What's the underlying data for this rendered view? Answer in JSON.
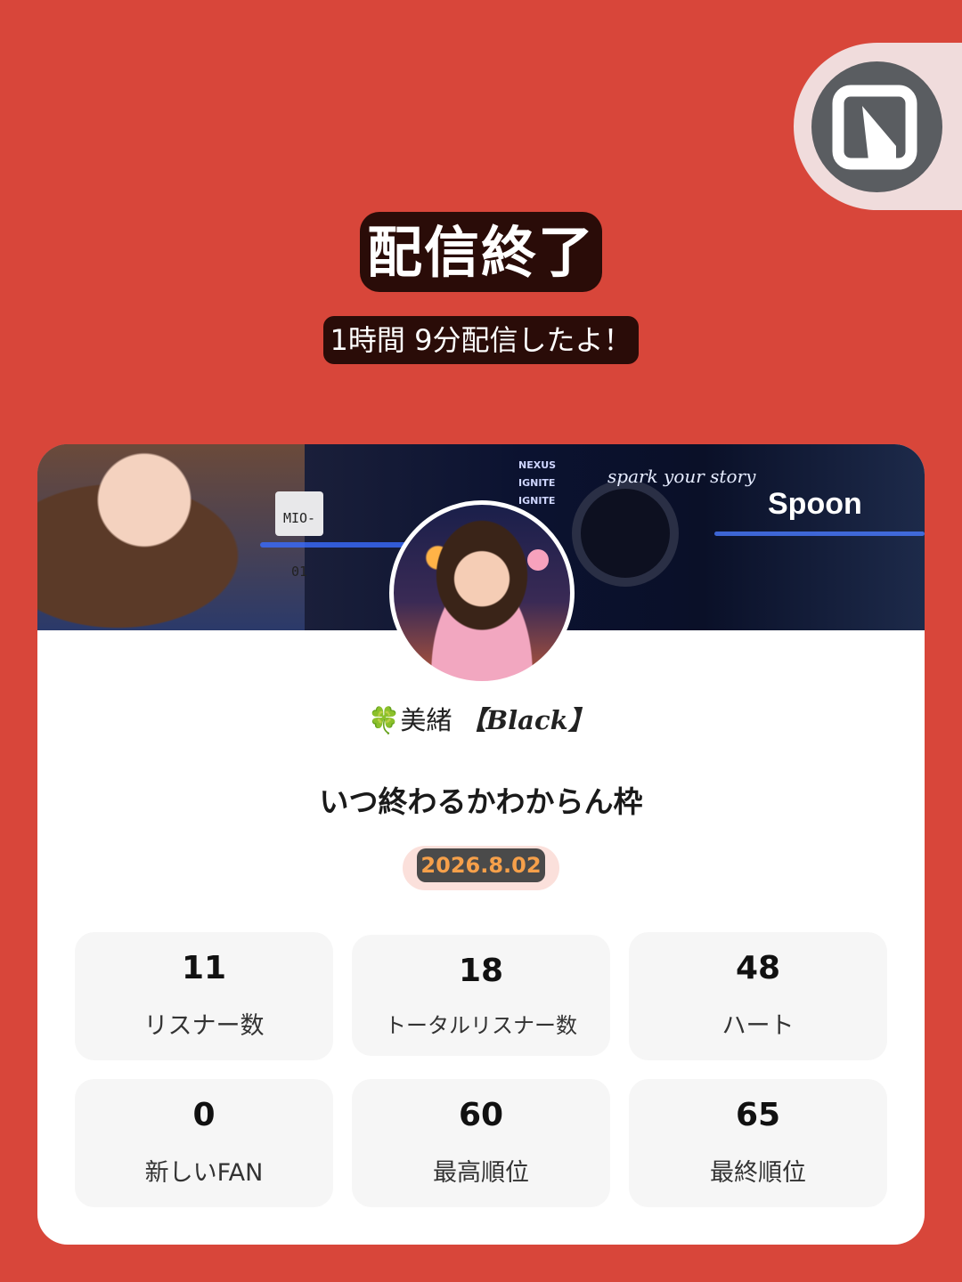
{
  "header": {
    "title": "配信終了",
    "subtitle": "1時間 9分配信したよ！"
  },
  "card": {
    "banner": {
      "plate": "MIO-01",
      "tag_lines": [
        "NEXUS",
        "IGNITE",
        "IGNITE"
      ],
      "tagline": "spark your story",
      "brand": "Spoon"
    },
    "user": {
      "clover": "🍀",
      "name": "美緒",
      "suffix": "【Black】"
    },
    "live_title": "いつ終わるかわからん枠",
    "date": "2026.8.02",
    "stats": [
      {
        "value": "11",
        "label": "リスナー数"
      },
      {
        "value": "18",
        "label": "トータルリスナー数"
      },
      {
        "value": "48",
        "label": "ハート"
      },
      {
        "value": "0",
        "label": "新しいFAN"
      },
      {
        "value": "60",
        "label": "最高順位"
      },
      {
        "value": "65",
        "label": "最終順位"
      }
    ]
  },
  "icons": {
    "corner": "app-logo-icon"
  },
  "colors": {
    "background": "#d8463a",
    "date_text": "#f6a04a"
  }
}
